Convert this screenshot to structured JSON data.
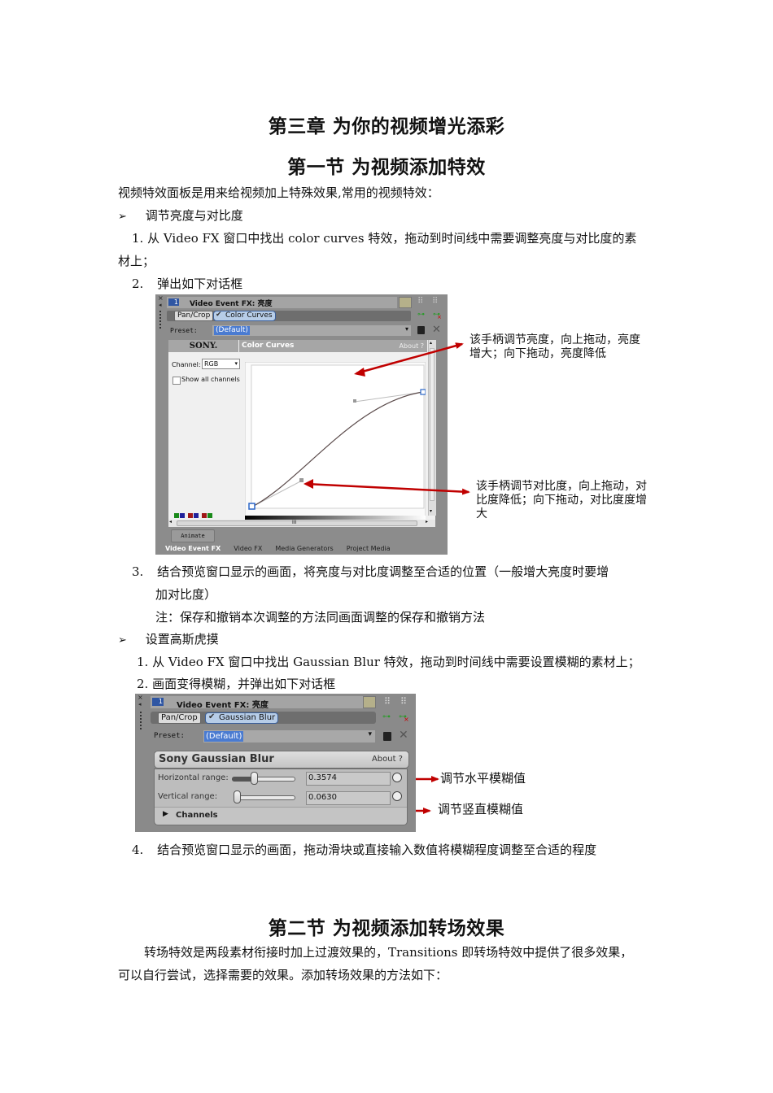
{
  "chapter_title": "第三章  为你的视频增光添彩",
  "section1": {
    "title": "第一节  为视频添加特效",
    "intro": "视频特效面板是用来给视频加上特殊效果,常用的视频特效：",
    "bullet_icon": "arrow-bullet-icon",
    "bullet_glyph": "➢",
    "topic1": {
      "heading": "调节亮度与对比度",
      "step1_line1": "1. 从 Video FX 窗口中找出 color curves 特效，拖动到时间线中需要调整亮度与对比度的素",
      "step1_line2": "材上；",
      "step2_num": "2.",
      "step2_text": "弹出如下对话框",
      "step3_num": "3.",
      "step3_line1": "结合预览窗口显示的画面，将亮度与对比度调整至合适的位置（一般增大亮度时要增",
      "step3_line2": "加对比度）",
      "note": "注：保存和撤销本次调整的方法同画面调整的保存和撤销方法"
    },
    "topic2": {
      "heading": "设置高斯虎摸",
      "step1": "1.  从 Video FX 窗口中找出 Gaussian Blur 特效，拖动到时间线中需要设置模糊的素材上；",
      "step2": "2.  画面变得模糊，并弹出如下对话框",
      "step4_num": "4.",
      "step4_text": "结合预览窗口显示的画面，拖动滑块或直接输入数值将模糊程度调整至合适的程度"
    }
  },
  "color_curves_dialog": {
    "track_badge": "1",
    "window_title": "Video Event FX: 亮度",
    "chain": [
      "Pan/Crop",
      "Color Curves"
    ],
    "preset_label": "Preset:",
    "preset_value": "(Default)",
    "brand": "SONY.",
    "plugin_name": "Color Curves",
    "about_label": "About  ?",
    "channel_label": "Channel:",
    "channel_value": "RGB",
    "show_all_channels": "Show all channels",
    "show_all_checked": false,
    "swatches": [
      "G",
      "B",
      "R",
      "B",
      "R",
      "G"
    ],
    "scroll_thumb": "III",
    "animate_label": "Animate",
    "tabs": [
      "Video Event FX",
      "Video FX",
      "Media Generators",
      "Project Media"
    ],
    "active_tab": "Video Event FX",
    "callout_brightness": [
      "该手柄调节亮度，向上拖动，亮度",
      "增大；向下拖动，亮度降低"
    ],
    "callout_contrast": [
      "该手柄调节对比度，向上拖动，对",
      "比度降低；向下拖动，对比度度增",
      "大"
    ]
  },
  "gaussian_blur_dialog": {
    "track_badge": "1",
    "window_title": "Video Event FX: 亮度",
    "chain": [
      "Pan/Crop",
      "Gaussian Blur"
    ],
    "preset_label": "Preset:",
    "preset_value": "(Default)",
    "plugin_name": "Sony Gaussian Blur",
    "about_label": "About   ?",
    "horizontal_label": "Horizontal range:",
    "horizontal_value": "0.3574",
    "vertical_label": "Vertical range:",
    "vertical_value": "0.0630",
    "channels_label": "Channels",
    "callout_horizontal": "调节水平模糊值",
    "callout_vertical": "调节竖直模糊值"
  },
  "section2": {
    "title": "第二节  为视频添加转场效果",
    "para_line1": "转场特效是两段素材衔接时加上过渡效果的，Transitions 即转场特效中提供了很多效果，",
    "para_line2": "可以自行尝试，选择需要的效果。添加转场效果的方法如下："
  },
  "colors": {
    "arrow_red": "#c00000",
    "selection_blue": "#4a7bd1"
  }
}
